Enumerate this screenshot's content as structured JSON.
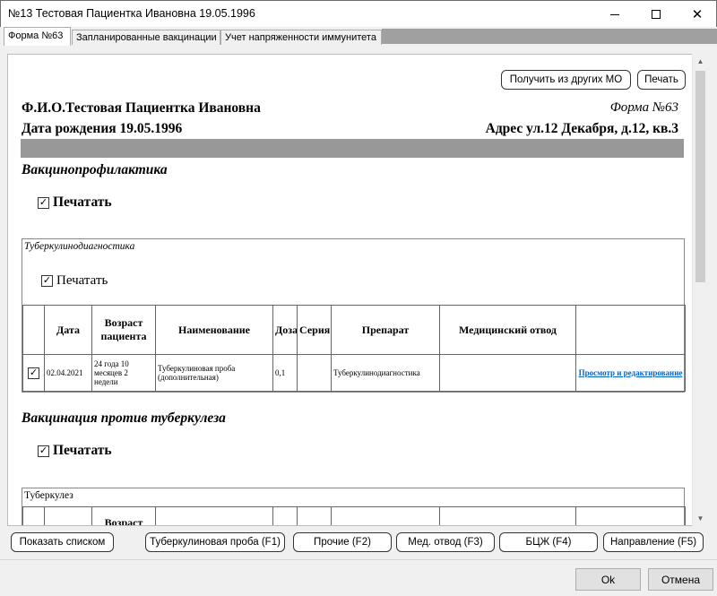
{
  "window": {
    "title": "№13 Тестовая Пациентка Ивановна 19.05.1996",
    "close_glyph": "✕"
  },
  "tabs": [
    {
      "label": "Форма №63",
      "active": true
    },
    {
      "label": "Запланированные вакцинации",
      "active": false
    },
    {
      "label": "Учет напряженности иммунитета",
      "active": false
    }
  ],
  "header_buttons": {
    "get_from_mo": "Получить из других МО",
    "print": "Печать"
  },
  "patient": {
    "fio": "Ф.И.О.Тестовая Пациентка Ивановна",
    "form": "Форма №63",
    "dob": "Дата рождения 19.05.1996",
    "address": "Адрес ул.12 Декабря, д.12, кв.3"
  },
  "sections": {
    "vaccine": {
      "title": "Вакцинопрофилактика",
      "print_label": "Печатать",
      "print_checked": true,
      "check_glyph": "✓"
    },
    "tuberculino": {
      "title": "Туберкулинодиагностика",
      "print_label": "Печатать",
      "print_checked": true,
      "check_glyph": "✓",
      "columns": [
        "Дата",
        "Возраст пациента",
        "Наименование",
        "Доза",
        "Серия",
        "Препарат",
        "Медицинский отвод"
      ],
      "rows": [
        {
          "checked": true,
          "check_glyph": "✓",
          "date": "02.04.2021",
          "age": "24 года 10 месяцев 2 недели",
          "name": "Туберкулиновая проба (дополнительная)",
          "dose": "0,1",
          "series": "",
          "drug": "Туберкулинодиагностика",
          "med_exempt": "",
          "action": "Просмотр и редактирование"
        }
      ]
    },
    "tb_vaccine": {
      "title": "Вакцинация против туберкулеза",
      "print_label": "Печатать",
      "print_checked": true,
      "check_glyph": "✓",
      "subtitle": "Туберкулез",
      "age_header": "Возраст"
    }
  },
  "scrollbar": {
    "up": "▲",
    "down": "▼"
  },
  "bottom_buttons": {
    "show_list": "Показать списком",
    "tb_test": "Туберкулиновая проба (F1)",
    "other": "Прочие (F2)",
    "med_exempt": "Мед. отвод (F3)",
    "bcg": "БЦЖ (F4)",
    "referral": "Направление (F5)"
  },
  "dialog": {
    "ok": "Ok",
    "cancel": "Отмена"
  },
  "colors": {
    "link": "#0563c1",
    "band": "#989898",
    "tab_strip": "#a0a0a0"
  }
}
